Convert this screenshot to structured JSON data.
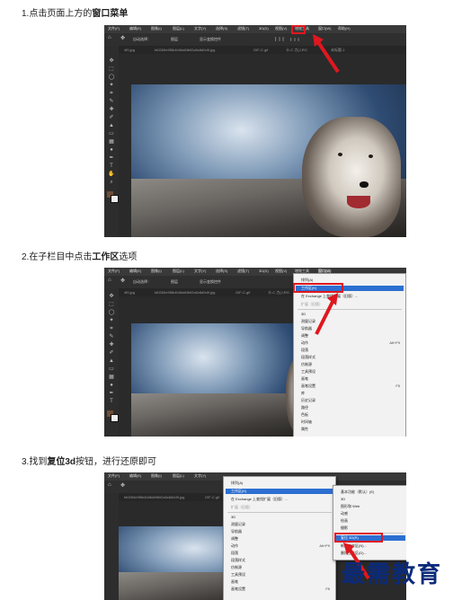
{
  "steps": {
    "step1": {
      "text": "1.点击页面上方的",
      "bold": "窗口菜单"
    },
    "step2": {
      "text": "2.在子栏目中点击",
      "bold": "工作区",
      "tail": "选项"
    },
    "step3": {
      "text": "3.找到",
      "bold": "复位3d",
      "tail": "按钮，进行还原即可"
    }
  },
  "menubar": {
    "items": [
      "文件(F)",
      "编辑(E)",
      "图像(I)",
      "图层(L)",
      "文字(Y)",
      "选择(S)",
      "滤镜(T)",
      "3D(D)",
      "视图(V)",
      "增效工具",
      "窗口(W)",
      "帮助(H)"
    ]
  },
  "optbar": {
    "auto_select": "自动选择：",
    "layer": "图层",
    "show_transform": "显示变换控件"
  },
  "tabs": {
    "tab1": "4f0.jpg",
    "tab2": "fd0260e9f5b4b0bd6fb92a5c8d0d9.jpg",
    "tab3": "GIF-C.gif",
    "tab4": "卡-C 力(J,RG",
    "tab5": "未标题-1"
  },
  "window_menu": {
    "items": [
      "排列(A)",
      "工作区(K)",
      "在 Exchange 上查找扩展（旧版）...",
      "扩展（旧版）",
      "3D",
      "测量记录",
      "导航器",
      "调整",
      "动作",
      "段落",
      "段落样式",
      "仿制源",
      "工具预设",
      "画笔",
      "画笔设置",
      "库",
      "历史记录",
      "路径",
      "色板",
      "时间轴",
      "属性"
    ],
    "shortcuts": {
      "action": "Alt+F9",
      "brush": "F5"
    }
  },
  "workspace_submenu": {
    "items": [
      "基本功能（默认）(E)",
      "3D",
      "图形和 Web",
      "动感",
      "绘画",
      "摄影",
      "复位 3D(R)",
      "新建工作区(N)...",
      "删除工作区(D)..."
    ]
  },
  "watermark": "最需教育",
  "colors": {
    "highlight": "#e0171f",
    "menu_select": "#2c6fd1",
    "ps_dark": "#2a2a2a"
  }
}
